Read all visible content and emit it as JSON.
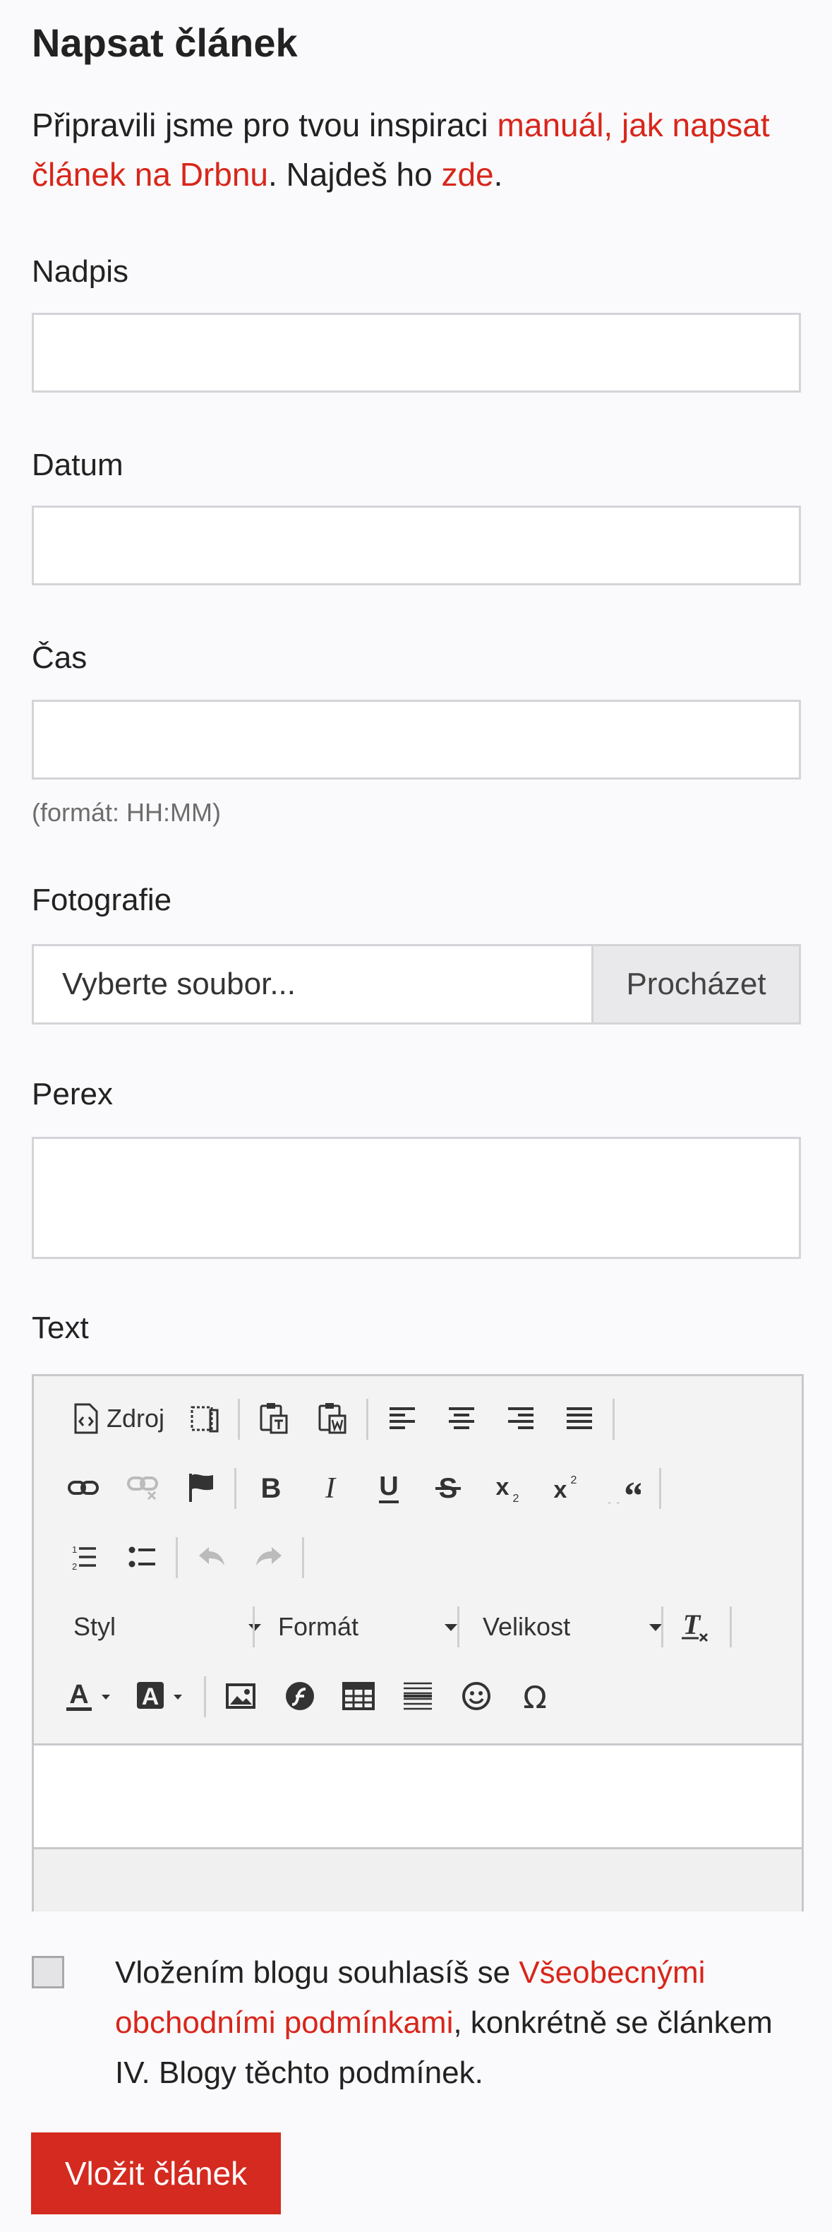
{
  "page": {
    "title": "Napsat článek",
    "intro": {
      "text_before": "Připravili jsme pro tvou inspiraci ",
      "link1": "manuál, jak napsat článek na Drbnu",
      "text_middle": ". Najdeš ho ",
      "link2": "zde",
      "text_after": "."
    }
  },
  "form": {
    "headline_label": "Nadpis",
    "headline_value": "",
    "date_label": "Datum",
    "date_value": "",
    "time_label": "Čas",
    "time_value": "",
    "time_hint": "(formát: HH:MM)",
    "photo_label": "Fotografie",
    "photo_placeholder": "Vyberte soubor...",
    "photo_button": "Procházet",
    "perex_label": "Perex",
    "perex_value": "",
    "text_label": "Text"
  },
  "editor": {
    "source_label": "Zdroj",
    "style_label": "Styl",
    "format_label": "Formát",
    "size_label": "Velikost",
    "icons": [
      "source-icon",
      "templates-icon",
      "paste-text-icon",
      "paste-word-icon",
      "align-left-icon",
      "align-center-icon",
      "align-right-icon",
      "justify-icon",
      "link-icon",
      "unlink-icon",
      "anchor-flag-icon",
      "bold-icon",
      "italic-icon",
      "underline-icon",
      "strike-icon",
      "subscript-icon",
      "superscript-icon",
      "blockquote-icon",
      "numbered-list-icon",
      "bulleted-list-icon",
      "undo-icon",
      "redo-icon",
      "remove-format-icon",
      "text-color-icon",
      "background-color-icon",
      "image-icon",
      "flash-icon",
      "table-icon",
      "horizontal-line-icon",
      "smiley-icon",
      "special-char-icon"
    ]
  },
  "consent": {
    "text_before": "Vložením blogu souhlasíš se ",
    "link": "Všeobecnými obchodními podmínkami",
    "text_after": ", konkrétně se článkem IV. Blogy těchto podmínek.",
    "checked": false
  },
  "submit_label": "Vložit článek",
  "colors": {
    "accent": "#d8261b",
    "button": "#d42a1f",
    "background": "#fafafc"
  }
}
